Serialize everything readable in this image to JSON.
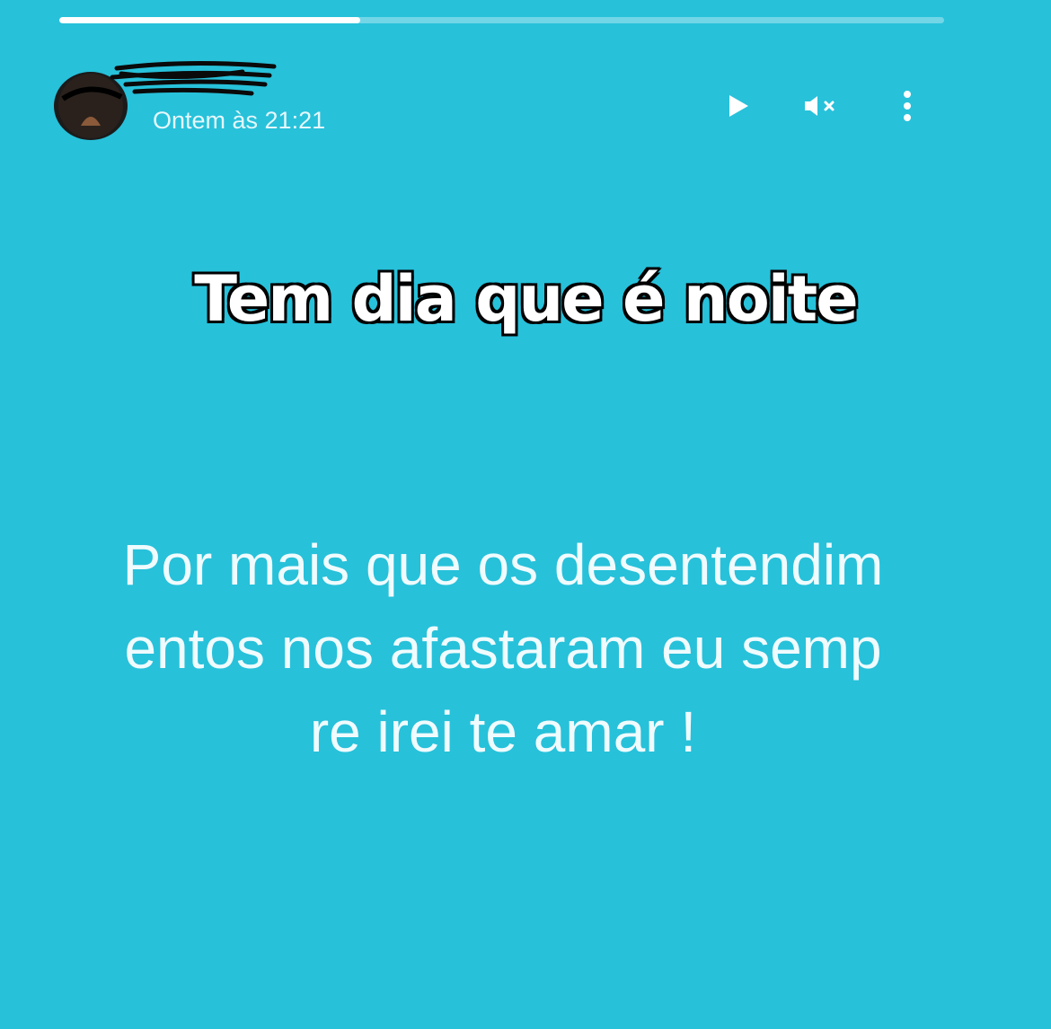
{
  "story": {
    "progress": 0.34,
    "timestamp": "Ontem às 21:21",
    "controls": {
      "play_icon": "play-icon",
      "mute_icon": "volume-mute-icon",
      "more_icon": "more-vertical-icon"
    },
    "overlay_caption": "Tem dia que é noite",
    "status_lines": [
      "Por mais que os desentendim",
      "entos nos afastaram eu semp",
      "re irei te amar !"
    ]
  },
  "colors": {
    "background": "#27c1da",
    "text": "#ffffff",
    "caption_outline": "#000000"
  }
}
